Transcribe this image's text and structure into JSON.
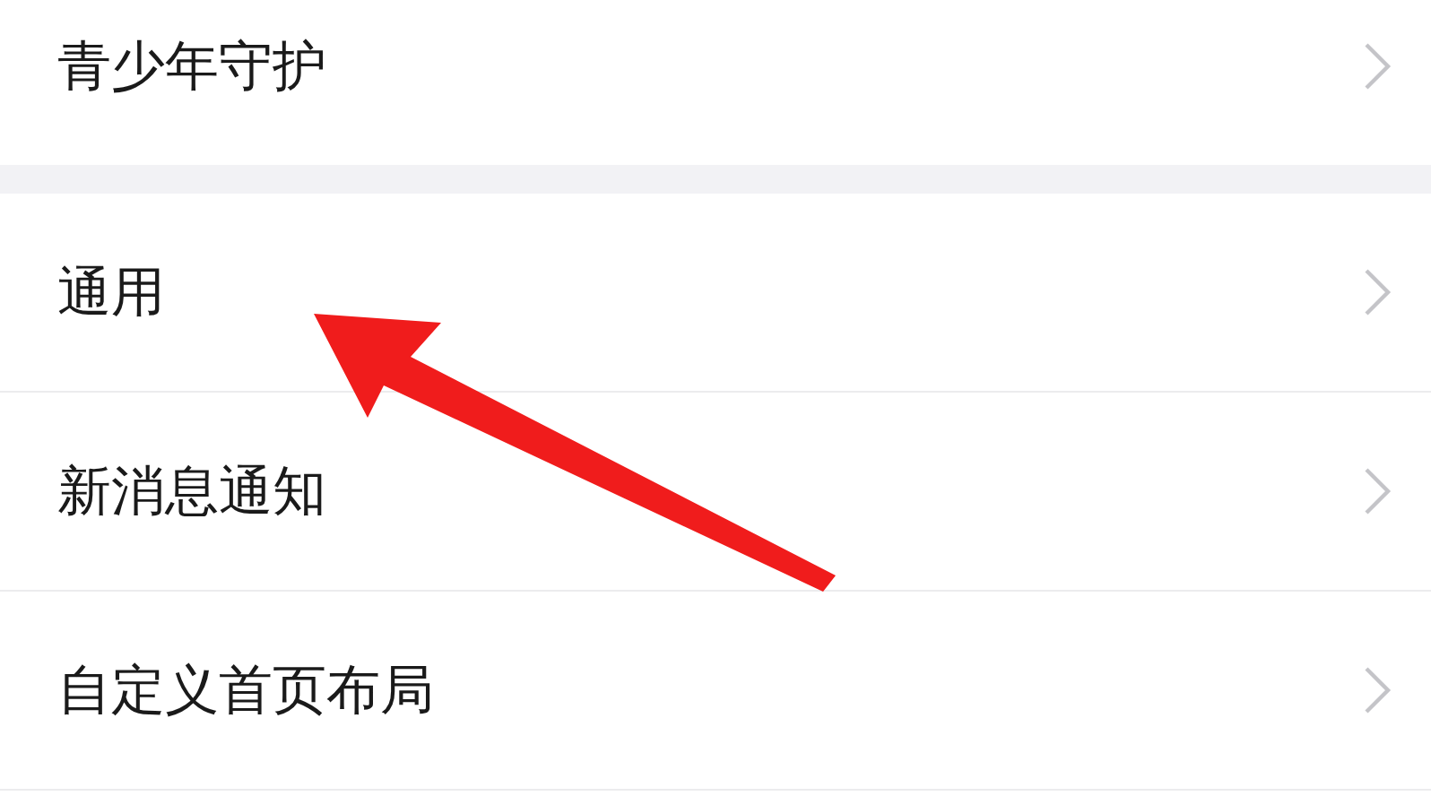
{
  "sections": [
    {
      "items": [
        {
          "label": "青少年守护"
        }
      ]
    },
    {
      "items": [
        {
          "label": "通用"
        },
        {
          "label": "新消息通知"
        },
        {
          "label": "自定义首页布局"
        }
      ]
    }
  ],
  "annotation": {
    "kind": "arrow"
  }
}
